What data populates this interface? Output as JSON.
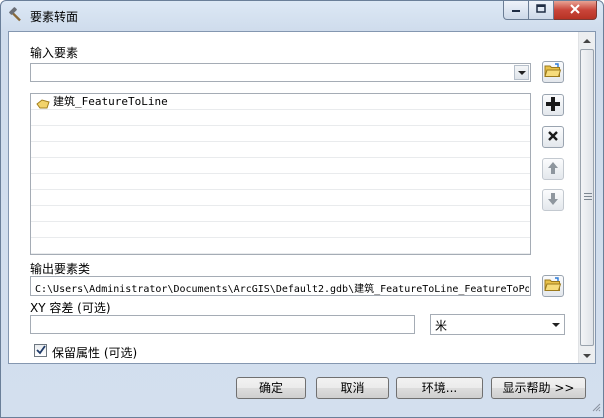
{
  "window": {
    "title": "要素转面"
  },
  "input_features": {
    "label": "输入要素",
    "value": "",
    "items": [
      {
        "label": "建筑_FeatureToLine"
      },
      {
        "label": ""
      },
      {
        "label": ""
      },
      {
        "label": ""
      },
      {
        "label": ""
      },
      {
        "label": ""
      },
      {
        "label": ""
      },
      {
        "label": ""
      },
      {
        "label": ""
      },
      {
        "label": ""
      }
    ]
  },
  "output_class": {
    "label": "输出要素类",
    "value": "C:\\Users\\Administrator\\Documents\\ArcGIS\\Default2.gdb\\建筑_FeatureToLine_FeatureToPo"
  },
  "xy_tolerance": {
    "label": "XY 容差 (可选)",
    "value": "",
    "unit": "米"
  },
  "preserve_attributes": {
    "label": "保留属性 (可选)",
    "checked": true
  },
  "buttons": {
    "ok": "确定",
    "cancel": "取消",
    "environments": "环境...",
    "show_help": "显示帮助 >>"
  },
  "colors": {
    "title_bg": "#d3dfee",
    "close_red": "#c9453a",
    "folder_yellow": "#e8c14a",
    "plus_black": "#1a1a1a"
  },
  "icons": {
    "app": "hammer-icon",
    "browse": "open-folder-icon",
    "add": "plus-icon",
    "remove": "x-icon",
    "up": "up-arrow-icon",
    "down": "down-arrow-icon",
    "feature": "polygon-feature-icon"
  }
}
